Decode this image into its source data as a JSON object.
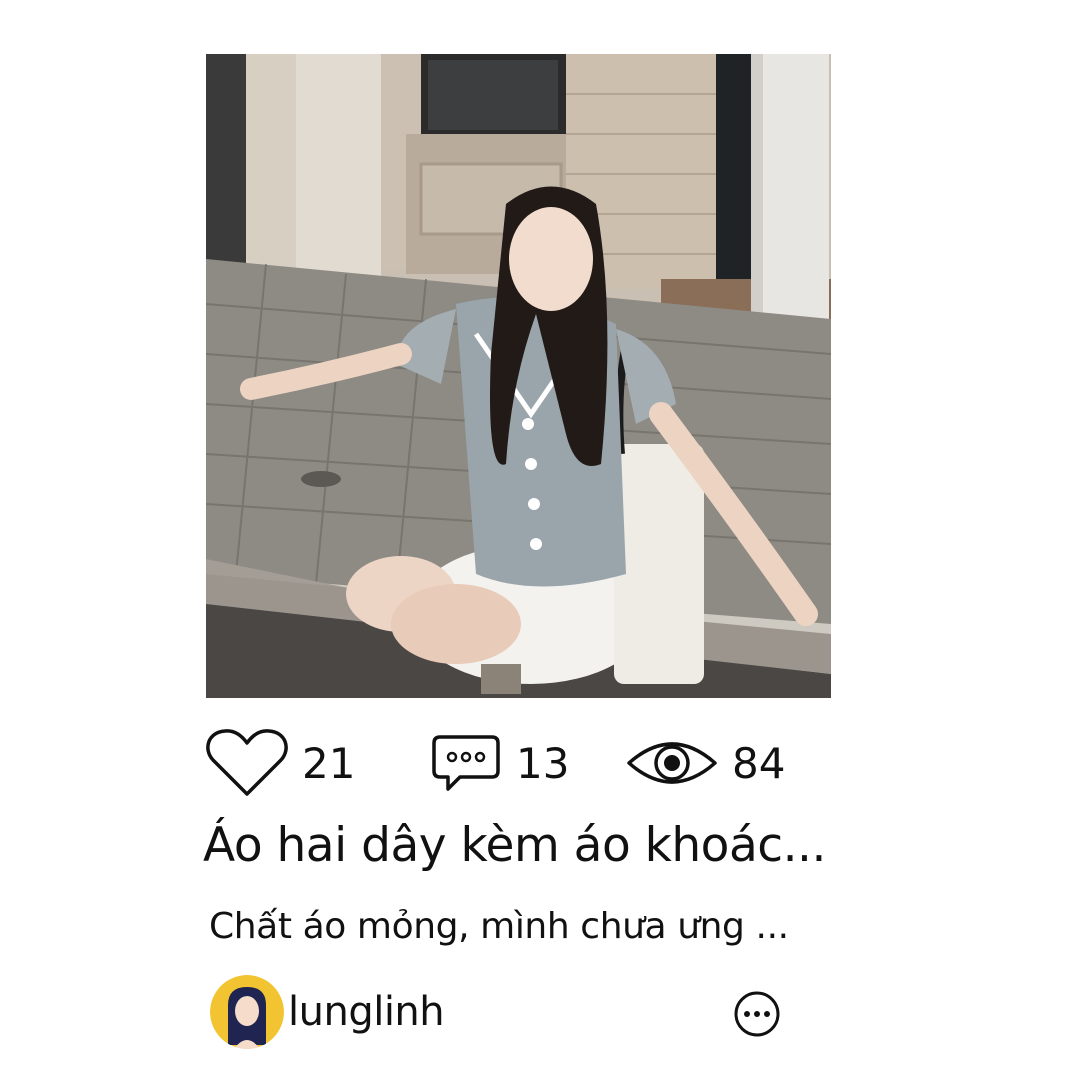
{
  "post": {
    "photo_alt": "",
    "stats": {
      "likes": "21",
      "comments": "13",
      "views": "84"
    },
    "title": "Áo hai dây kèm áo khoác...",
    "description": "Chất áo mỏng, mình chưa ưng ...",
    "author": {
      "username": "lunglinh"
    },
    "icons": {
      "like": "heart-icon",
      "comment": "chat-bubble-icon",
      "view": "eye-icon",
      "more": "more-options-icon"
    }
  },
  "colors": {
    "text": "#111111",
    "avatar_bg": "#f3c431",
    "background": "#ffffff"
  }
}
